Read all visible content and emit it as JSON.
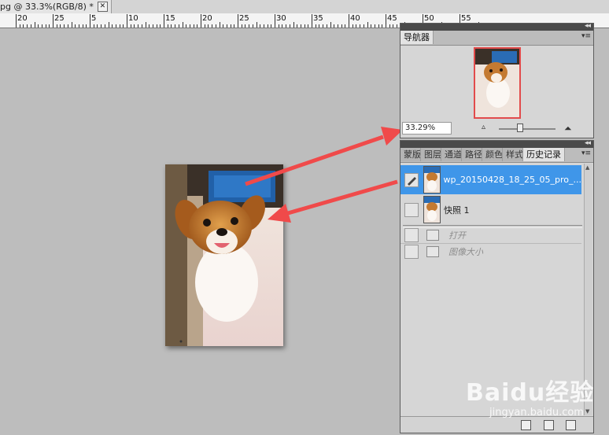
{
  "document_tab": {
    "title": "pg @ 33.3%(RGB/8) *",
    "close_glyph": "✕"
  },
  "ruler": {
    "labels": [
      "20",
      "25",
      "5",
      "10",
      "15",
      "20",
      "25",
      "30",
      "35",
      "40",
      "45",
      "50",
      "55"
    ]
  },
  "navigator": {
    "tab_label": "导航器",
    "zoom_value": "33.29%",
    "zoom_level": 0.333,
    "collapse_glyph": "◂◂",
    "menu_glyph": "▾≡"
  },
  "history_panel": {
    "tabs": [
      "蒙版",
      "图层",
      "通道",
      "路径",
      "颜色",
      "样式",
      "历史记录"
    ],
    "active_tab": "历史记录",
    "snapshot_rows": [
      {
        "label": "wp_20150428_18_25_05_pro_...",
        "selected": true
      },
      {
        "label": "快照 1",
        "selected": false
      }
    ],
    "step_rows": [
      {
        "label": "打开"
      },
      {
        "label": "图像大小"
      }
    ],
    "collapse_glyph": "◂◂",
    "menu_glyph": "▾≡"
  },
  "watermark": {
    "brand": "Baidu经验",
    "url": "jingyan.baidu.com"
  },
  "colors": {
    "arrow": "#f04a4a",
    "selection": "#3f96e9",
    "canvas": "#bdbdbd"
  }
}
